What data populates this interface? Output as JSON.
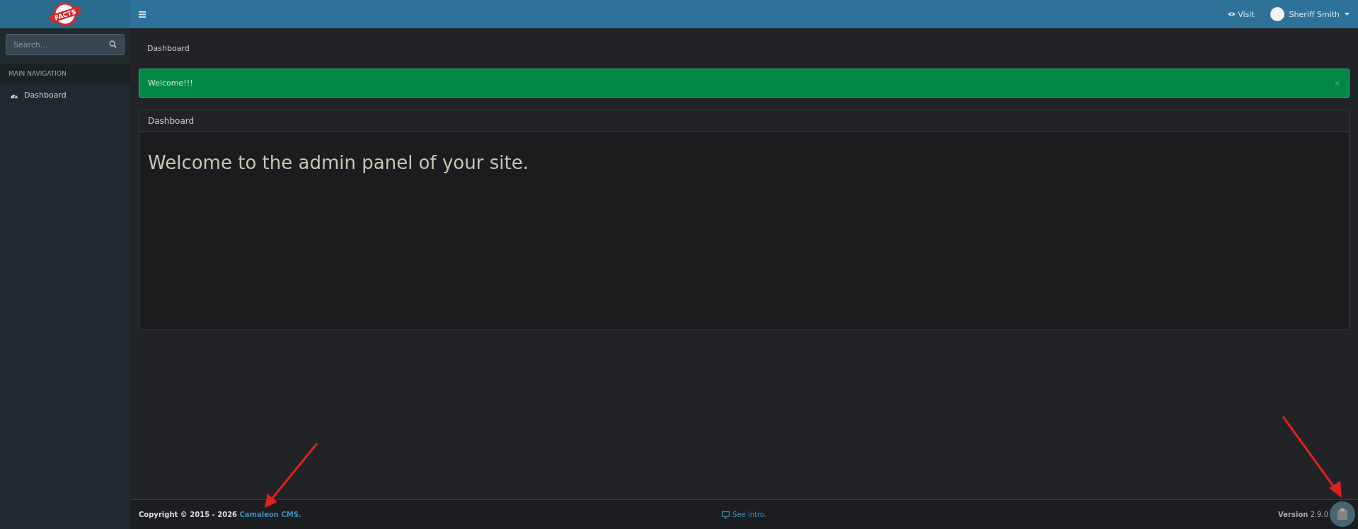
{
  "logo": {
    "text": "FACTS"
  },
  "header": {
    "visit": "Visit",
    "user": "Sheriff Smith"
  },
  "sidebar": {
    "search": {
      "placeholder": "Search..."
    },
    "section": "MAIN NAVIGATION",
    "items": [
      {
        "label": "Dashboard",
        "selected": false
      }
    ]
  },
  "breadcrumb": "Dashboard",
  "alert": {
    "text": "Welcome!!!",
    "close": "×"
  },
  "card": {
    "title": "Dashboard",
    "body": "Welcome to the admin panel of your site."
  },
  "footer": {
    "copyright": "Copyright © 2015 - 2026 ",
    "link": "Camaleon CMS.",
    "intro": "See intro.",
    "version": "**Version** 2.9.0"
  }
}
